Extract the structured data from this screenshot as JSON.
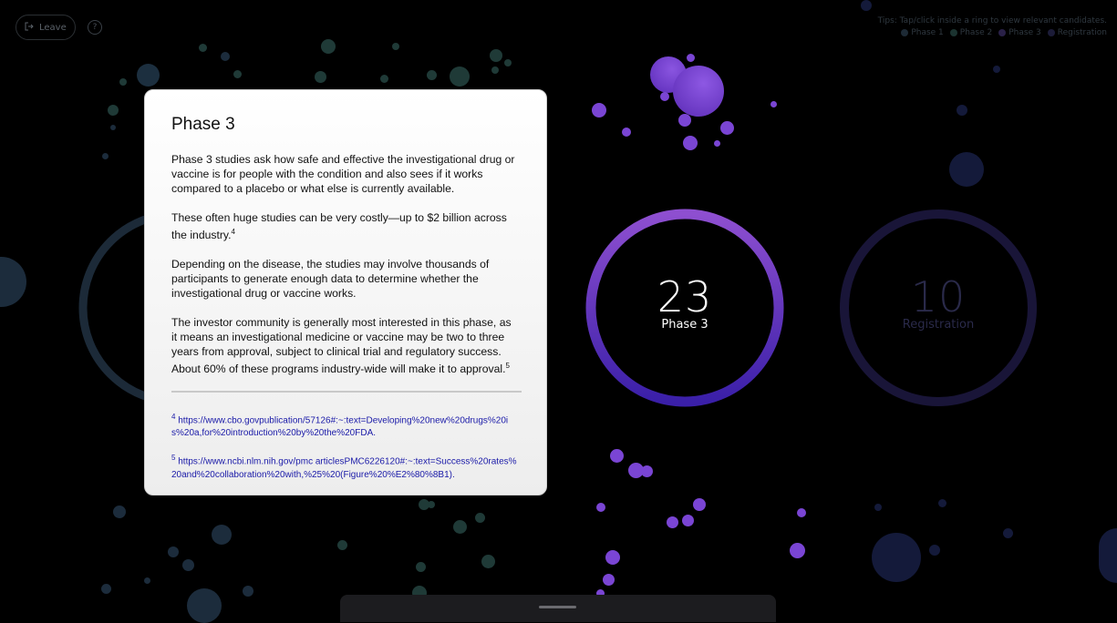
{
  "header": {
    "leave_label": "Leave",
    "help_label": "?"
  },
  "tips": {
    "text": "Tips: Tap/click inside a ring to view relevant candidates.",
    "legend": [
      {
        "label": "Phase 1",
        "color": "#1d2a35"
      },
      {
        "label": "Phase 2",
        "color": "#1b3330"
      },
      {
        "label": "Phase 3",
        "color": "#2a2148"
      },
      {
        "label": "Registration",
        "color": "#1c1c38"
      }
    ]
  },
  "rings": [
    {
      "number": "23",
      "label": "Phase 3"
    },
    {
      "number": "10",
      "label": "Registration"
    }
  ],
  "card": {
    "title": "Phase 3",
    "paragraphs": [
      "Phase 3 studies ask how safe and effective the investigational drug or vaccine is for people with the condition and also sees if it works compared to a placebo or what else is currently available.",
      "These often huge studies can be very costly—up to $2 billion across the industry.",
      "Depending on the disease, the studies may involve thousands of participants to generate enough data to determine whether the investigational drug or vaccine works.",
      "The investor community is generally most interested in this phase, as it means an investigational medicine or vaccine may be two to three years from approval, subject to clinical trial and regulatory success. About 60% of these programs industry-wide will make it to approval."
    ],
    "sup_1": "4",
    "sup_2": "5",
    "footnotes": [
      {
        "num": "4",
        "text": "https://www.cbo.govpublication/57126#:~:text=Developing%20new%20drugs%20is%20a,for%20introduction%20by%20the%20FDA."
      },
      {
        "num": "5",
        "text": "https://www.ncbi.nlm.nih.gov/pmc articlesPMC6226120#:~:text=Success%20rates%20and%20collaboration%20with,%25%20(Figure%20%E2%80%8B1)."
      }
    ]
  },
  "colors": {
    "phase3_ring_top": "#8e4fd0",
    "phase3_ring_bottom": "#3a1fa8",
    "registration_ring": "#191538",
    "bubble_green": "#1f3a37",
    "bubble_blue": "#1c2c3c",
    "bubble_purple": "#7e48d6"
  }
}
